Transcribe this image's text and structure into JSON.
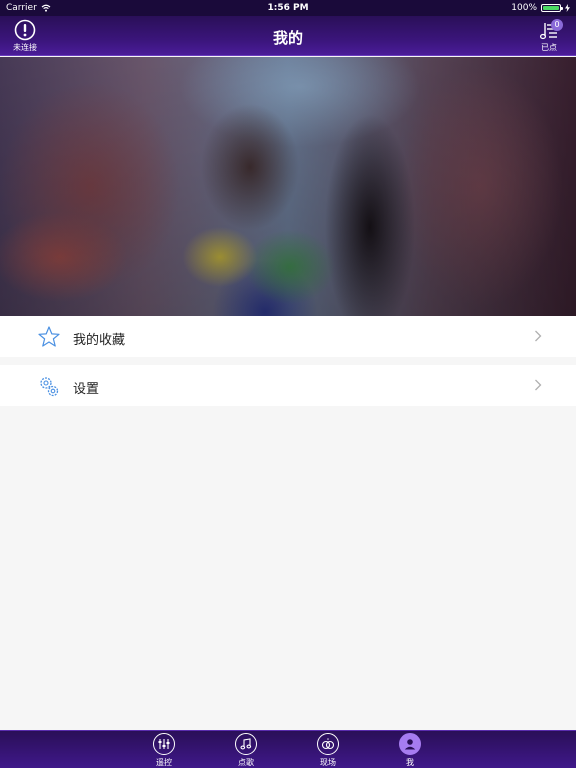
{
  "status_bar": {
    "carrier": "Carrier",
    "time": "1:56 PM",
    "battery": "100%",
    "battery_level": 1.0
  },
  "nav": {
    "title": "我的",
    "left_label": "未连接",
    "left_icon": "alert-circle-icon",
    "right_label": "已点",
    "right_icon": "music-list-icon",
    "badge_count": "0"
  },
  "menu": {
    "items": [
      {
        "label": "我的收藏",
        "icon": "star-icon"
      },
      {
        "label": "设置",
        "icon": "gears-icon"
      }
    ]
  },
  "tabbar": {
    "tabs": [
      {
        "label": "遥控",
        "icon": "sliders-icon",
        "active": false
      },
      {
        "label": "点歌",
        "icon": "music-note-icon",
        "active": false
      },
      {
        "label": "现场",
        "icon": "rings-icon",
        "active": false
      },
      {
        "label": "我",
        "icon": "user-icon",
        "active": true
      }
    ]
  },
  "colors": {
    "nav_bg": "#3a157a",
    "accent": "#a67cf0",
    "menu_icon": "#4a90e2"
  }
}
